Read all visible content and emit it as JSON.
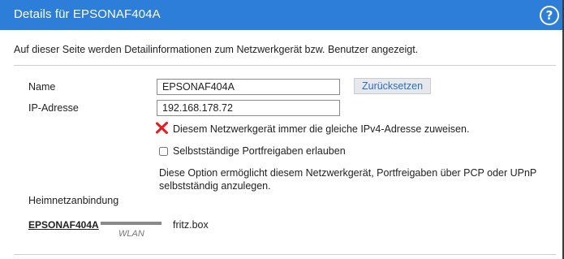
{
  "dialog": {
    "title": "Details für EPSONAF404A",
    "help_label": "?",
    "intro": "Auf dieser Seite werden Detailinformationen zum Netzwerkgerät bzw. Benutzer angezeigt."
  },
  "form": {
    "name_label": "Name",
    "name_value": "EPSONAF404A",
    "reset_label": "Zurücksetzen",
    "ip_label": "IP-Adresse",
    "ip_value": "192.168.178.72",
    "static_ip_label": "Diesem Netzwerkgerät immer die gleiche IPv4-Adresse zuweisen.",
    "static_ip_enabled": false,
    "portfw_label": "Selbstständige Portfreigaben erlauben",
    "portfw_checked": false,
    "portfw_note": "Diese Option ermöglicht diesem Netzwerkgerät, Portfreigaben über PCP oder UPnP selbstständig anzulegen."
  },
  "home_network": {
    "heading": "Heimnetzanbindung",
    "device": "EPSONAF404A",
    "connection_type": "WLAN",
    "router": "fritz.box"
  },
  "colors": {
    "titlebar": "#2d7ed9",
    "accent_text": "#2a6fc4",
    "disabled_x": "#e02020"
  }
}
